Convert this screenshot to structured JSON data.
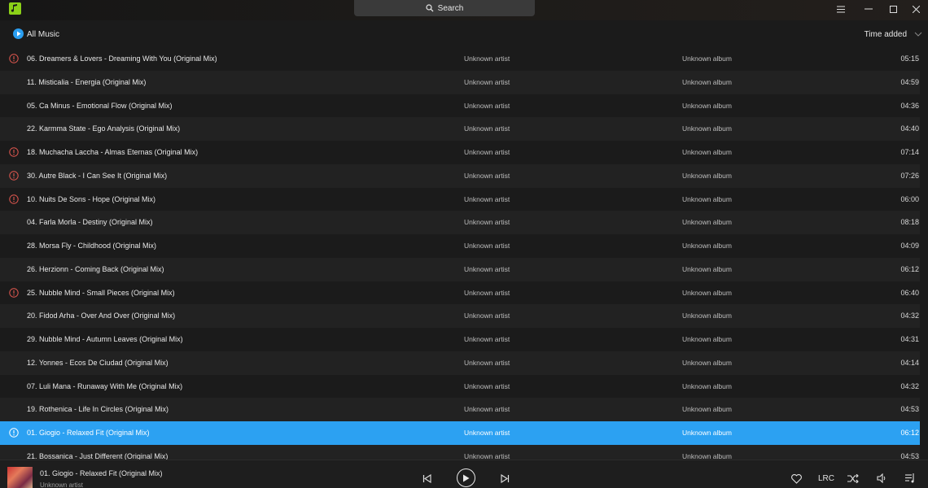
{
  "titlebar": {
    "search_label": "Search"
  },
  "toolbar": {
    "all_music_label": "All Music",
    "sort_label": "Time added"
  },
  "tracks": [
    {
      "title": "06.  Dreamers & Lovers  -  Dreaming With You (Original Mix)",
      "artist": "Unknown artist",
      "album": "Unknown album",
      "duration": "05:15",
      "warning": true
    },
    {
      "title": "11.  Misticalia  -  Energia (Original Mix)",
      "artist": "Unknown artist",
      "album": "Unknown album",
      "duration": "04:59",
      "warning": false
    },
    {
      "title": "05.  Ca Minus  -  Emotional Flow (Original Mix)",
      "artist": "Unknown artist",
      "album": "Unknown album",
      "duration": "04:36",
      "warning": false
    },
    {
      "title": "22.  Karmma State  -  Ego Analysis (Original Mix)",
      "artist": "Unknown artist",
      "album": "Unknown album",
      "duration": "04:40",
      "warning": false
    },
    {
      "title": "18.  Muchacha Laccha  -  Almas Eternas (Original Mix)",
      "artist": "Unknown artist",
      "album": "Unknown album",
      "duration": "07:14",
      "warning": true
    },
    {
      "title": "30.  Autre Black  -  I Can See It (Original Mix)",
      "artist": "Unknown artist",
      "album": "Unknown album",
      "duration": "07:26",
      "warning": true
    },
    {
      "title": "10.  Nuits De Sons  -  Hope (Original Mix)",
      "artist": "Unknown artist",
      "album": "Unknown album",
      "duration": "06:00",
      "warning": true
    },
    {
      "title": "04.  Farla Morla  -  Destiny (Original Mix)",
      "artist": "Unknown artist",
      "album": "Unknown album",
      "duration": "08:18",
      "warning": false
    },
    {
      "title": "28.  Morsa Fly  -  Childhood (Original Mix)",
      "artist": "Unknown artist",
      "album": "Unknown album",
      "duration": "04:09",
      "warning": false
    },
    {
      "title": "26.  Herzionn  -  Coming Back (Original Mix)",
      "artist": "Unknown artist",
      "album": "Unknown album",
      "duration": "06:12",
      "warning": false
    },
    {
      "title": "25.  Nubble Mind  -  Small Pieces (Original Mix)",
      "artist": "Unknown artist",
      "album": "Unknown album",
      "duration": "06:40",
      "warning": true
    },
    {
      "title": "20.  Fidod Arha  -  Over And Over (Original Mix)",
      "artist": "Unknown artist",
      "album": "Unknown album",
      "duration": "04:32",
      "warning": false
    },
    {
      "title": "29.  Nubble Mind  -  Autumn Leaves (Original Mix)",
      "artist": "Unknown artist",
      "album": "Unknown album",
      "duration": "04:31",
      "warning": false
    },
    {
      "title": "12.  Yonnes  -  Ecos De Ciudad (Original Mix)",
      "artist": "Unknown artist",
      "album": "Unknown album",
      "duration": "04:14",
      "warning": false
    },
    {
      "title": "07.  Luli Mana  -  Runaway With Me (Original Mix)",
      "artist": "Unknown artist",
      "album": "Unknown album",
      "duration": "04:32",
      "warning": false
    },
    {
      "title": "19.  Rothenica  -  Life In Circles (Original Mix)",
      "artist": "Unknown artist",
      "album": "Unknown album",
      "duration": "04:53",
      "warning": false
    },
    {
      "title": "01.  Giogio  -  Relaxed Fit (Original Mix)",
      "artist": "Unknown artist",
      "album": "Unknown album",
      "duration": "06:12",
      "warning": true,
      "selected": true
    },
    {
      "title": "21.  Bossanica  -  Just Different (Original Mix)",
      "artist": "Unknown artist",
      "album": "Unknown album",
      "duration": "04:53",
      "warning": false
    }
  ],
  "player": {
    "now_playing_title": "01.  Giogio  -  Relaxed Fit (Original Mix)",
    "now_playing_artist": "Unknown artist",
    "lrc_label": "LRC"
  },
  "colors": {
    "accent": "#2ca1f2",
    "warning": "#e0574f",
    "logo": "#8bd018"
  },
  "icons": [
    "app-logo-icon",
    "search-icon",
    "menu-icon",
    "minimize-icon",
    "maximize-icon",
    "close-icon",
    "all-music-icon",
    "chevron-down-icon",
    "warning-icon",
    "previous-icon",
    "play-icon",
    "next-icon",
    "heart-icon",
    "shuffle-icon",
    "volume-icon",
    "playlist-icon"
  ]
}
